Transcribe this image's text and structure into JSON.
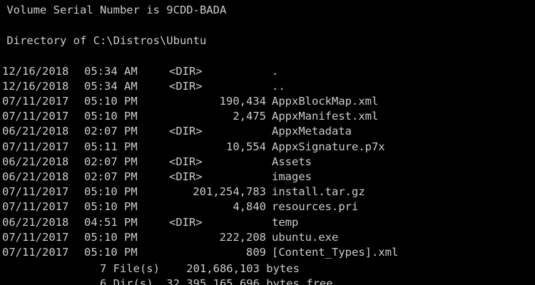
{
  "terminal": {
    "colors": {
      "background": "#000000",
      "foreground": "#cccccc"
    },
    "header": {
      "volume_serial": " Volume Serial Number is 9CDD-BADA",
      "blank": "",
      "directory_of": " Directory of C:\\Distros\\Ubuntu"
    },
    "entries": [
      {
        "date": "12/16/2018",
        "time": "05:34 AM",
        "dir": "<DIR>",
        "size": "",
        "name": "."
      },
      {
        "date": "12/16/2018",
        "time": "05:34 AM",
        "dir": "<DIR>",
        "size": "",
        "name": ".."
      },
      {
        "date": "07/11/2017",
        "time": "05:10 PM",
        "dir": "",
        "size": "190,434",
        "name": "AppxBlockMap.xml"
      },
      {
        "date": "07/11/2017",
        "time": "05:10 PM",
        "dir": "",
        "size": "2,475",
        "name": "AppxManifest.xml"
      },
      {
        "date": "06/21/2018",
        "time": "02:07 PM",
        "dir": "<DIR>",
        "size": "",
        "name": "AppxMetadata"
      },
      {
        "date": "07/11/2017",
        "time": "05:11 PM",
        "dir": "",
        "size": "10,554",
        "name": "AppxSignature.p7x"
      },
      {
        "date": "06/21/2018",
        "time": "02:07 PM",
        "dir": "<DIR>",
        "size": "",
        "name": "Assets"
      },
      {
        "date": "06/21/2018",
        "time": "02:07 PM",
        "dir": "<DIR>",
        "size": "",
        "name": "images"
      },
      {
        "date": "07/11/2017",
        "time": "05:10 PM",
        "dir": "",
        "size": "201,254,783",
        "name": "install.tar.gz"
      },
      {
        "date": "07/11/2017",
        "time": "05:10 PM",
        "dir": "",
        "size": "4,840",
        "name": "resources.pri"
      },
      {
        "date": "06/21/2018",
        "time": "04:51 PM",
        "dir": "<DIR>",
        "size": "",
        "name": "temp"
      },
      {
        "date": "07/11/2017",
        "time": "05:10 PM",
        "dir": "",
        "size": "222,208",
        "name": "ubuntu.exe"
      },
      {
        "date": "07/11/2017",
        "time": "05:10 PM",
        "dir": "",
        "size": "809",
        "name": "[Content_Types].xml"
      }
    ],
    "summary": {
      "files_line": "               7 File(s)    201,686,103 bytes",
      "dirs_line": "               6 Dir(s)  32,395,165,696 bytes free"
    }
  }
}
